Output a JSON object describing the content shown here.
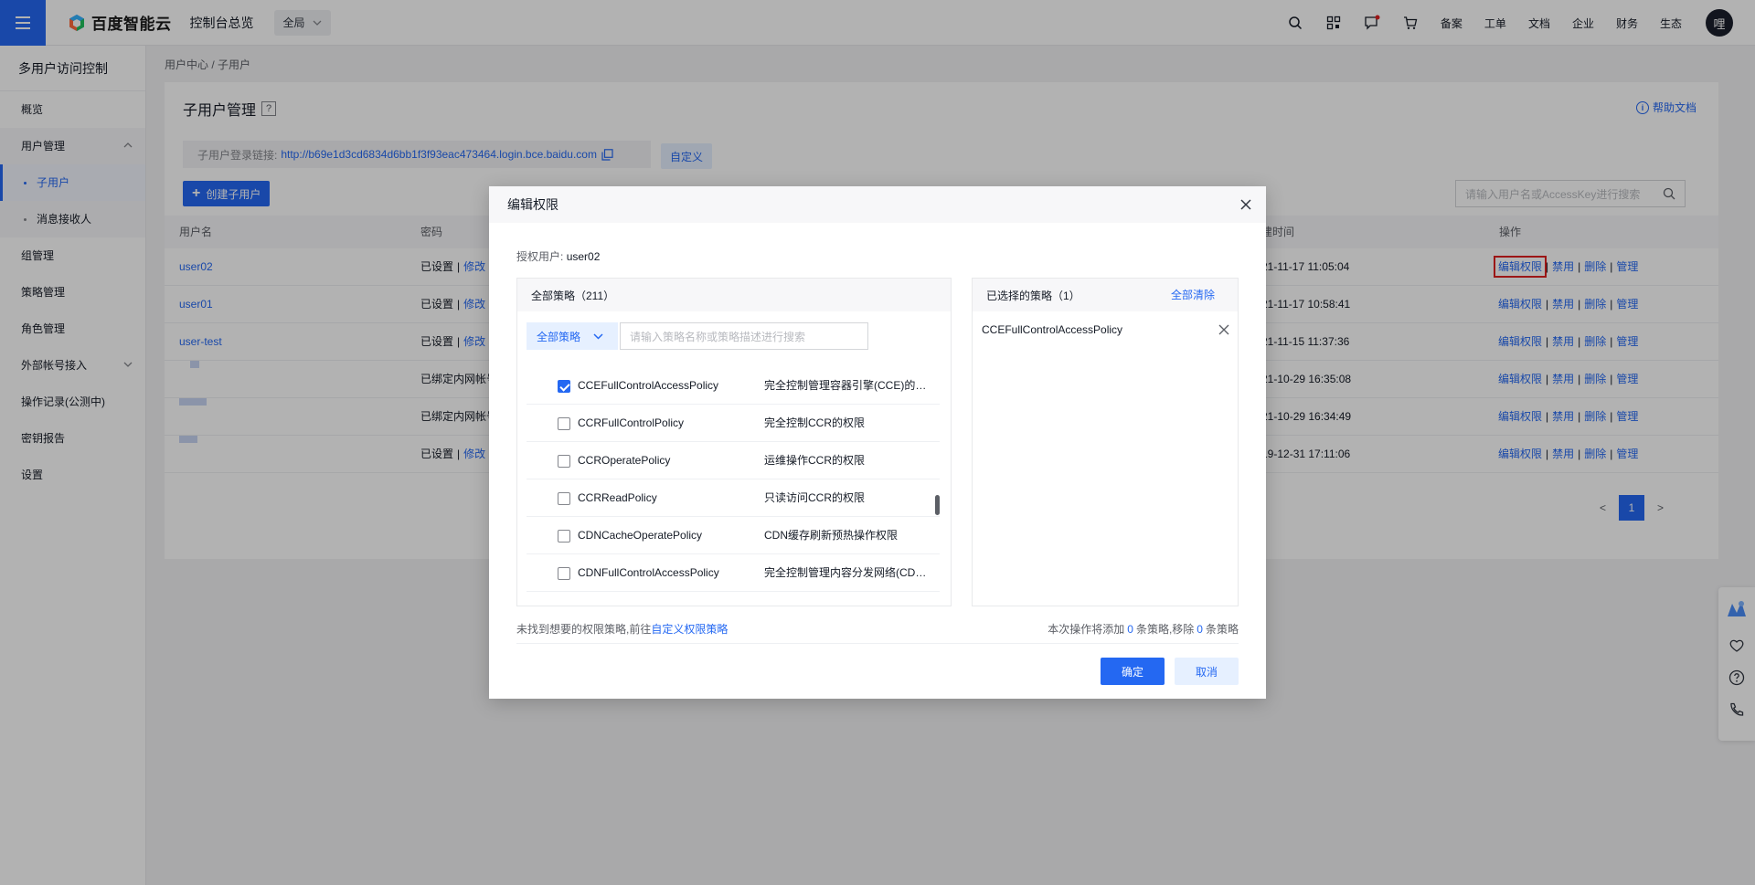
{
  "topbar": {
    "logo_text": "百度智能云",
    "console_title": "控制台总览",
    "region": "全局",
    "links": [
      "备案",
      "工单",
      "文档",
      "企业",
      "财务",
      "生态"
    ],
    "avatar_text": "哩"
  },
  "sidebar": {
    "title": "多用户访问控制",
    "items": [
      {
        "label": "概览"
      },
      {
        "label": "用户管理"
      },
      {
        "label": "子用户"
      },
      {
        "label": "消息接收人"
      },
      {
        "label": "组管理"
      },
      {
        "label": "策略管理"
      },
      {
        "label": "角色管理"
      },
      {
        "label": "外部帐号接入"
      },
      {
        "label": "操作记录(公测中)"
      },
      {
        "label": "密钥报告"
      },
      {
        "label": "设置"
      }
    ]
  },
  "breadcrumb": {
    "root": "用户中心",
    "current": "子用户"
  },
  "page": {
    "title": "子用户管理",
    "help": "帮助文档",
    "login_label": "子用户登录链接:",
    "login_url": "http://b69e1d3cd6834d6bb1f3f93eac473464.login.bce.baidu.com",
    "custom_btn": "自定义",
    "create_btn": "创建子用户",
    "search_placeholder": "请输入用户名或AccessKey进行搜索"
  },
  "table": {
    "headers": {
      "username": "用户名",
      "password": "密码",
      "created": "建时间",
      "ops": "操作"
    },
    "rows": [
      {
        "username": "user02",
        "password": "已设置",
        "pwd_action": "修改",
        "created": "21-11-17 11:05:04"
      },
      {
        "username": "user01",
        "password": "已设置",
        "pwd_action": "修改",
        "created": "21-11-17 10:58:41"
      },
      {
        "username": "user-test",
        "password": "已设置",
        "pwd_action": "修改",
        "created": "21-11-15 11:37:36"
      },
      {
        "username": "",
        "password": "已绑定内网帐号",
        "pwd_action": "",
        "created": "21-10-29 16:35:08"
      },
      {
        "username": "",
        "password": "已绑定内网帐号",
        "pwd_action": "",
        "created": "21-10-29 16:34:49"
      },
      {
        "username": "",
        "password": "已设置",
        "pwd_action": "修改",
        "created": "19-12-31 17:11:06"
      }
    ],
    "op_labels": {
      "edit": "编辑权限",
      "disable": "禁用",
      "delete": "删除",
      "manage": "管理"
    }
  },
  "pager": {
    "prev": "<",
    "page": "1",
    "next": ">"
  },
  "modal": {
    "title": "编辑权限",
    "auth_user_label": "授权用户:",
    "auth_user": "user02",
    "all_policies": "全部策略（211）",
    "filter_select": "全部策略",
    "filter_placeholder": "请输入策略名称或策略描述进行搜索",
    "policies": [
      {
        "name": "CCEFullControlAccessPolicy",
        "desc": "完全控制管理容器引擎(CCE)的权限",
        "checked": true
      },
      {
        "name": "CCRFullControlPolicy",
        "desc": "完全控制CCR的权限",
        "checked": false
      },
      {
        "name": "CCROperatePolicy",
        "desc": "运维操作CCR的权限",
        "checked": false
      },
      {
        "name": "CCRReadPolicy",
        "desc": "只读访问CCR的权限",
        "checked": false
      },
      {
        "name": "CDNCacheOperatePolicy",
        "desc": "CDN缓存刷新预热操作权限",
        "checked": false
      },
      {
        "name": "CDNFullControlAccessPolicy",
        "desc": "完全控制管理内容分发网络(CDN)的权限",
        "checked": false
      }
    ],
    "selected_title": "已选择的策略（1）",
    "clear_all": "全部清除",
    "selected": [
      "CCEFullControlAccessPolicy"
    ],
    "foot_note_prefix": "未找到想要的权限策略,前往",
    "foot_note_link": "自定义权限策略",
    "count_prefix": "本次操作将添加",
    "count_add": "0",
    "count_mid": "条策略,移除",
    "count_remove": "0",
    "count_suffix": "条策略",
    "ok": "确定",
    "cancel": "取消"
  },
  "colors": {
    "accent": "#2468f2",
    "highlight": "#e02020"
  }
}
